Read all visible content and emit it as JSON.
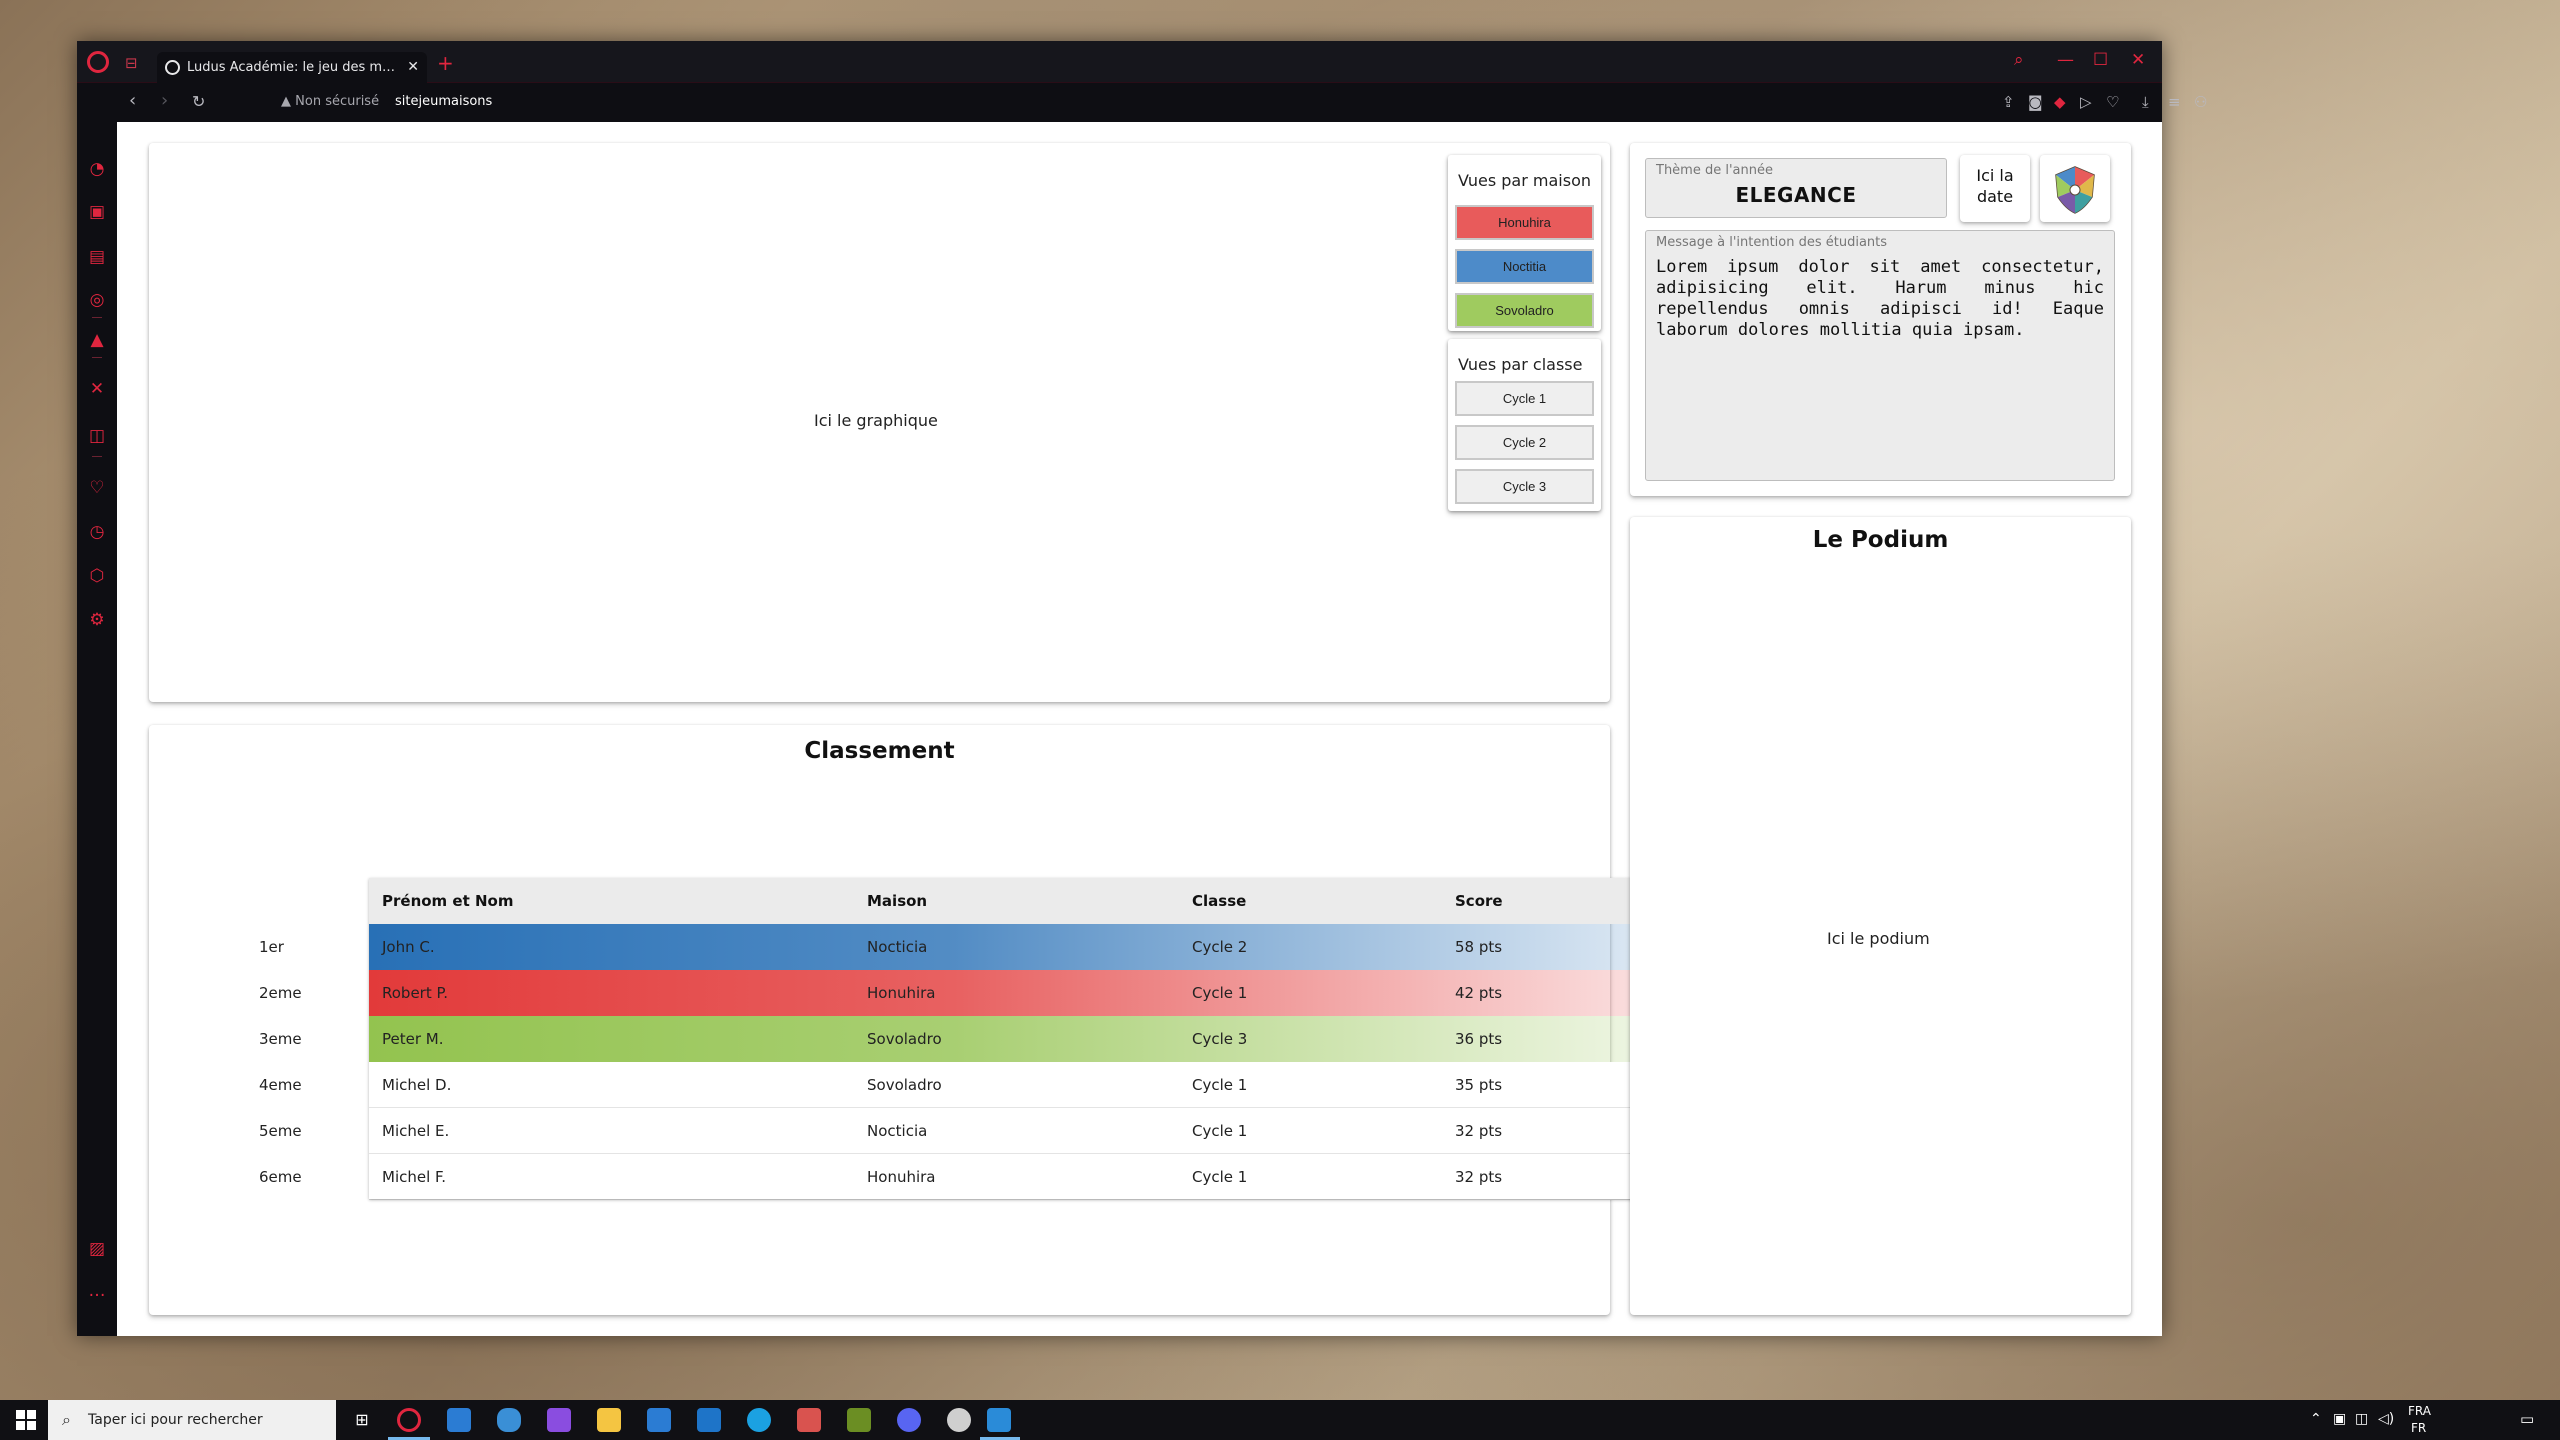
{
  "browser": {
    "tab_title": "Ludus Académie: le jeu des maisons",
    "security_label": "Non sécurisé",
    "url": "sitejeumaisons",
    "accent_color": "#e0263f"
  },
  "chart_card": {
    "placeholder": "Ici le graphique"
  },
  "views_by_house": {
    "title": "Vues par maison",
    "buttons": [
      {
        "label": "Honuhira",
        "color": "#e85b5b"
      },
      {
        "label": "Noctitia",
        "color": "#4d8bc9"
      },
      {
        "label": "Sovoladro",
        "color": "#9fcb5f"
      }
    ]
  },
  "views_by_class": {
    "title": "Vues par classe",
    "buttons": [
      {
        "label": "Cycle 1"
      },
      {
        "label": "Cycle 2"
      },
      {
        "label": "Cycle 3"
      }
    ]
  },
  "theme": {
    "label": "Thème de l'année",
    "value": "ELEGANCE"
  },
  "date_box": {
    "text": "Ici la date"
  },
  "message": {
    "label": "Message à l'intention des étudiants",
    "text": "Lorem ipsum dolor sit amet consectetur, adipisicing elit. Harum minus hic repellendus omnis adipisci id! Eaque laborum dolores mollitia quia ipsam."
  },
  "podium": {
    "title": "Le Podium",
    "placeholder": "Ici le podium"
  },
  "ranking": {
    "title": "Classement",
    "columns": [
      "Prénom et Nom",
      "Maison",
      "Classe",
      "Score"
    ],
    "rows": [
      {
        "rank": "1er",
        "name": "John C.",
        "house": "Nocticia",
        "class": "Cycle 2",
        "score": "58 pts"
      },
      {
        "rank": "2eme",
        "name": "Robert P.",
        "house": "Honuhira",
        "class": "Cycle 1",
        "score": "42 pts"
      },
      {
        "rank": "3eme",
        "name": "Peter M.",
        "house": "Sovoladro",
        "class": "Cycle 3",
        "score": "36 pts"
      },
      {
        "rank": "4eme",
        "name": "Michel D.",
        "house": "Sovoladro",
        "class": "Cycle 1",
        "score": "35 pts"
      },
      {
        "rank": "5eme",
        "name": "Michel E.",
        "house": "Nocticia",
        "class": "Cycle 1",
        "score": "32 pts"
      },
      {
        "rank": "6eme",
        "name": "Michel F.",
        "house": "Honuhira",
        "class": "Cycle 1",
        "score": "32 pts"
      }
    ],
    "podium_colors": {
      "first": "#2870b6",
      "second": "#e23a3a",
      "third": "#93c34f"
    }
  },
  "taskbar": {
    "search_placeholder": "Taper ici pour rechercher",
    "lang_top": "FRA",
    "lang_bottom": "FR"
  }
}
